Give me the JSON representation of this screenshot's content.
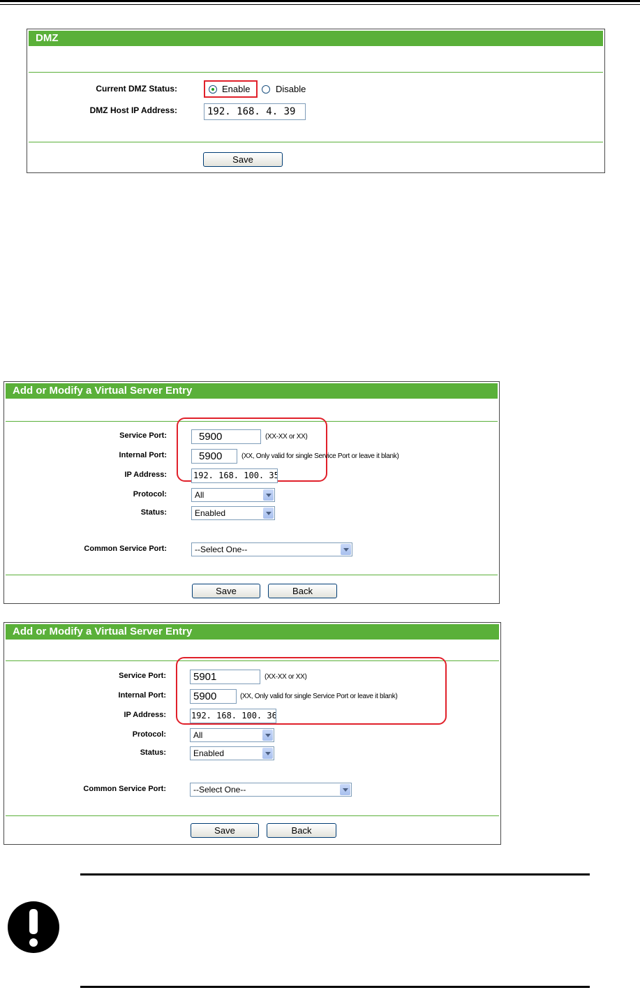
{
  "dmz": {
    "title": "DMZ",
    "status_label": "Current DMZ Status:",
    "enable_label": "Enable",
    "disable_label": "Disable",
    "selected": "Enable",
    "host_label": "DMZ Host IP Address:",
    "host_value": "192. 168. 4. 39",
    "save_label": "Save"
  },
  "vs1": {
    "title": "Add or Modify a Virtual Server Entry",
    "service_port_label": "Service Port:",
    "service_port_value": "5900",
    "service_port_hint": "(XX-XX or XX)",
    "internal_port_label": "Internal Port:",
    "internal_port_value": "5900",
    "internal_port_hint": "(XX, Only valid for single Service Port or leave it blank)",
    "ip_label": "IP Address:",
    "ip_value": "192. 168. 100. 35",
    "protocol_label": "Protocol:",
    "protocol_value": "All",
    "status_label": "Status:",
    "status_value": "Enabled",
    "common_label": "Common Service Port:",
    "common_value": "--Select One--",
    "save_label": "Save",
    "back_label": "Back"
  },
  "vs2": {
    "title": "Add or Modify a Virtual Server Entry",
    "service_port_label": "Service Port:",
    "service_port_value": "5901",
    "service_port_hint": "(XX-XX or XX)",
    "internal_port_label": "Internal Port:",
    "internal_port_value": "5900",
    "internal_port_hint": "(XX, Only valid for single Service Port or leave it blank)",
    "ip_label": "IP Address:",
    "ip_value": "192. 168. 100. 36",
    "protocol_label": "Protocol:",
    "protocol_value": "All",
    "status_label": "Status:",
    "status_value": "Enabled",
    "common_label": "Common Service Port:",
    "common_value": "--Select One--",
    "save_label": "Save",
    "back_label": "Back"
  },
  "notice": {
    "icon": "exclamation-icon"
  },
  "colors": {
    "header_green": "#5ab039",
    "highlight_red": "#e0202a"
  }
}
